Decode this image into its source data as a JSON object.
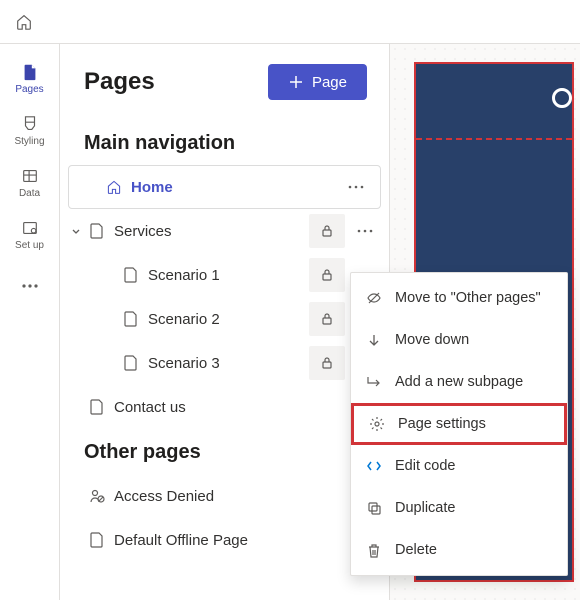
{
  "rail": {
    "items": [
      {
        "label": "Pages"
      },
      {
        "label": "Styling"
      },
      {
        "label": "Data"
      },
      {
        "label": "Set up"
      }
    ]
  },
  "panel": {
    "title": "Pages",
    "addButton": "Page"
  },
  "sections": {
    "main": "Main navigation",
    "other": "Other pages"
  },
  "tree": {
    "home": "Home",
    "services": "Services",
    "scenario1": "Scenario 1",
    "scenario2": "Scenario 2",
    "scenario3": "Scenario 3",
    "contact": "Contact us",
    "accessDenied": "Access Denied",
    "defaultOffline": "Default Offline Page"
  },
  "menu": {
    "moveToOther": "Move to \"Other pages\"",
    "moveDown": "Move down",
    "addSubpage": "Add a new subpage",
    "pageSettings": "Page settings",
    "editCode": "Edit code",
    "duplicate": "Duplicate",
    "delete": "Delete"
  }
}
